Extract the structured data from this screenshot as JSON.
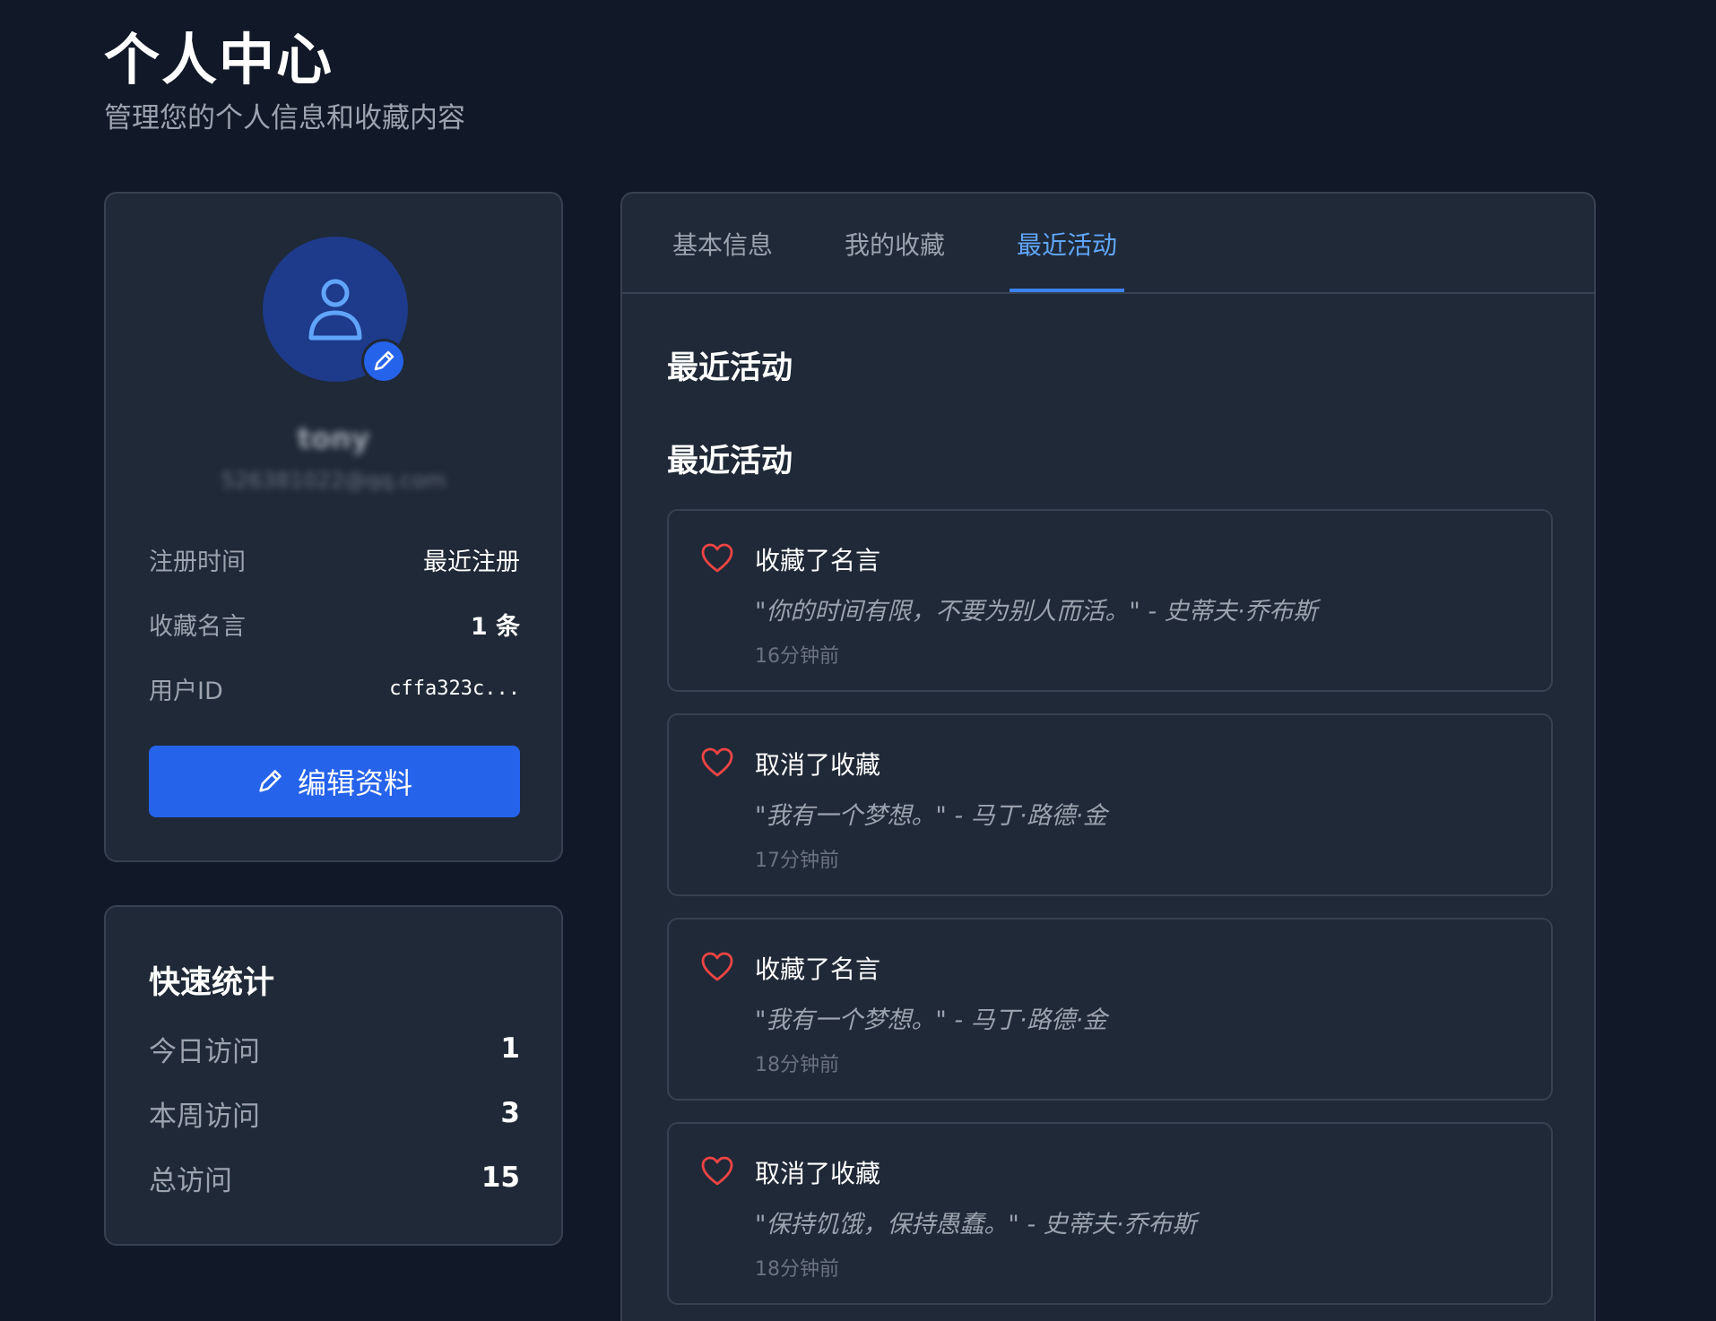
{
  "header": {
    "title": "个人中心",
    "subtitle": "管理您的个人信息和收藏内容"
  },
  "profile": {
    "username": "tony",
    "email": "526381022@qq.com",
    "rows": [
      {
        "label": "注册时间",
        "value": "最近注册"
      },
      {
        "label": "收藏名言",
        "value": "1 条"
      },
      {
        "label": "用户ID",
        "value": "cffa323c..."
      }
    ],
    "edit_button_label": "编辑资料"
  },
  "stats": {
    "title": "快速统计",
    "rows": [
      {
        "label": "今日访问",
        "value": "1"
      },
      {
        "label": "本周访问",
        "value": "3"
      },
      {
        "label": "总访问",
        "value": "15"
      }
    ]
  },
  "tabs": [
    {
      "label": "基本信息",
      "active": false
    },
    {
      "label": "我的收藏",
      "active": false
    },
    {
      "label": "最近活动",
      "active": true
    }
  ],
  "main": {
    "heading": "最近活动",
    "subheading": "最近活动",
    "activities": [
      {
        "icon": "heart-icon",
        "title": "收藏了名言",
        "quote": "\"你的时间有限，不要为别人而活。\" - 史蒂夫·乔布斯",
        "time": "16分钟前"
      },
      {
        "icon": "heart-icon",
        "title": "取消了收藏",
        "quote": "\"我有一个梦想。\" - 马丁·路德·金",
        "time": "17分钟前"
      },
      {
        "icon": "heart-icon",
        "title": "收藏了名言",
        "quote": "\"我有一个梦想。\" - 马丁·路德·金",
        "time": "18分钟前"
      },
      {
        "icon": "heart-icon",
        "title": "取消了收藏",
        "quote": "\"保持饥饿，保持愚蠢。\" - 史蒂夫·乔布斯",
        "time": "18分钟前"
      }
    ]
  },
  "colors": {
    "background": "#111827",
    "card": "#1f2937",
    "accent": "#2563eb",
    "tab_active": "#60a5fa",
    "heart": "#ef4444"
  }
}
